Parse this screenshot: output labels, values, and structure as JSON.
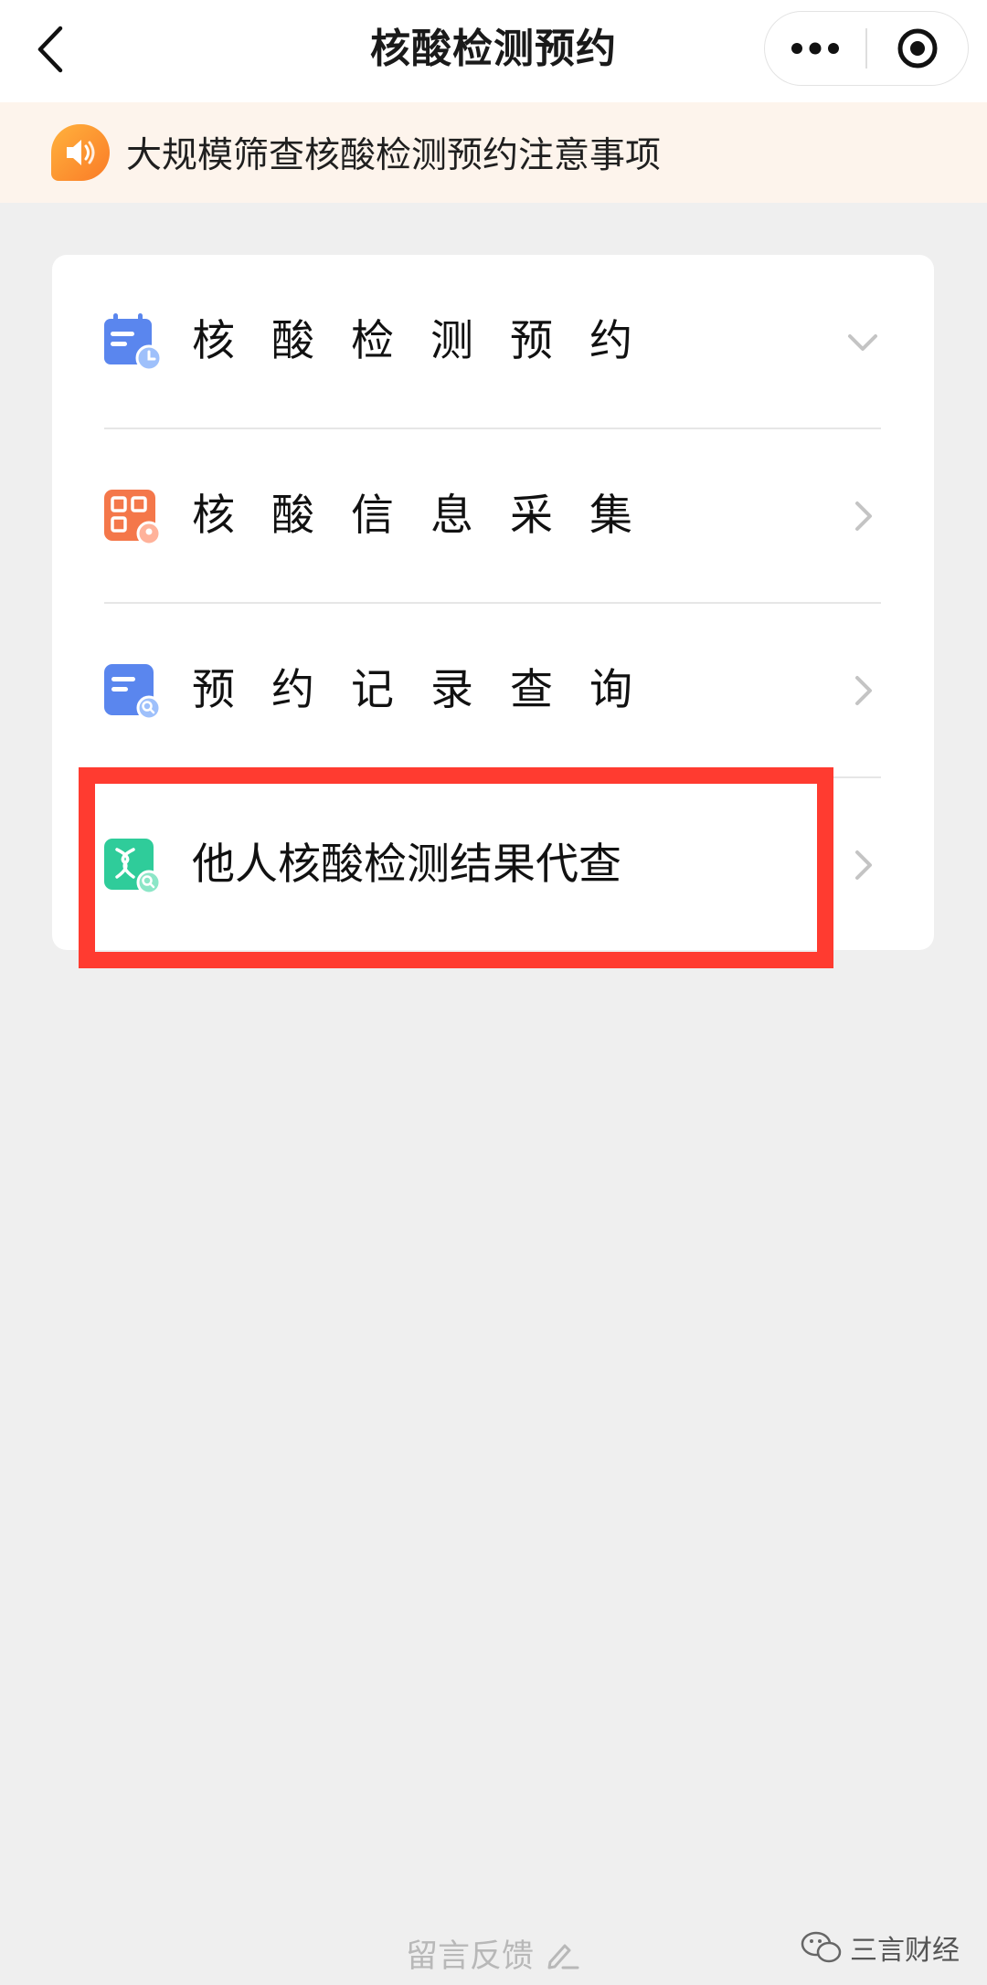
{
  "header": {
    "title": "核酸检测预约"
  },
  "notice": {
    "text": "大规模筛查核酸检测预约注意事项"
  },
  "menu": {
    "items": [
      {
        "label": "核酸检测预约",
        "icon": "calendar-clock-icon",
        "chevron": "chevron-down-icon"
      },
      {
        "label": "核酸信息采集",
        "icon": "qr-code-icon",
        "chevron": "chevron-right-icon"
      },
      {
        "label": "预约记录查询",
        "icon": "document-search-icon",
        "chevron": "chevron-right-icon"
      },
      {
        "label": "他人核酸检测结果代查",
        "icon": "dna-search-icon",
        "chevron": "chevron-right-icon"
      }
    ]
  },
  "footer": {
    "feedback_label": "留言反馈"
  },
  "watermark": {
    "text": "三言财经"
  },
  "colors": {
    "highlight": "#ff3b30",
    "notice_bg": "#fdf4ec",
    "page_bg": "#efefef"
  }
}
